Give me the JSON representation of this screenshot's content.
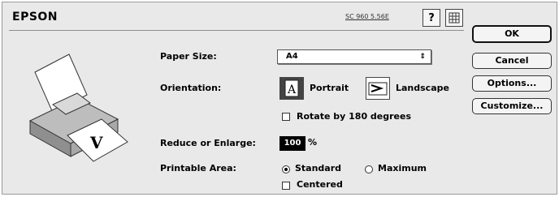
{
  "header": {
    "brand": "EPSON",
    "version": "SC 960 5.56E",
    "help_label": "?"
  },
  "paper_size": {
    "label": "Paper Size:",
    "value": "A4"
  },
  "orientation": {
    "label": "Orientation:",
    "portrait_label": "Portrait",
    "landscape_label": "Landscape",
    "selected": "Portrait",
    "rotate_label": "Rotate by 180 degrees",
    "rotate_checked": false
  },
  "scale": {
    "label": "Reduce or Enlarge:",
    "value": "100",
    "unit": "%"
  },
  "printable_area": {
    "label": "Printable Area:",
    "standard_label": "Standard",
    "maximum_label": "Maximum",
    "selected": "Standard",
    "centered_label": "Centered",
    "centered_checked": false
  },
  "buttons": {
    "ok": "OK",
    "cancel": "Cancel",
    "options": "Options...",
    "customize": "Customize..."
  },
  "icons": {
    "help": "help-icon",
    "grid": "grid-icon",
    "printer": "printer-illustration",
    "portrait": "portrait-orientation-icon",
    "landscape": "landscape-orientation-icon"
  }
}
